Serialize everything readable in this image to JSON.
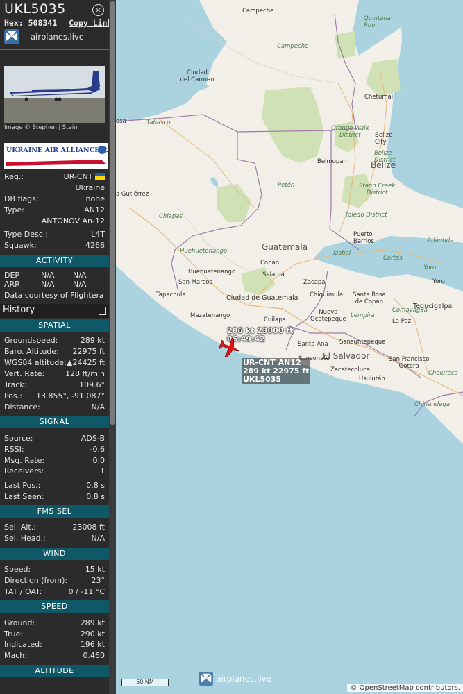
{
  "header": {
    "callsign": "UKL5035",
    "hex_label": "Hex:",
    "hex": "508341",
    "copy_link": "Copy Link",
    "site": "airplanes.live",
    "close": "×"
  },
  "photo": {
    "credit": "Image © Stephen J Stein"
  },
  "operator_logo": {
    "text": "UKRAINE AIR ALLIANCE P.JSC."
  },
  "aircraft": {
    "reg_label": "Reg.:",
    "reg": "UR-CNT",
    "country": "Ukraine",
    "dbflags_label": "DB flags:",
    "dbflags": "none",
    "type_label": "Type:",
    "type": "AN12",
    "type_name": "ANTONOV An-12",
    "typedesc_label": "Type Desc.:",
    "typedesc": "L4T",
    "squawk_label": "Squawk:",
    "squawk": "4266"
  },
  "activity": {
    "title": "ACTIVITY",
    "dep_label": "DEP",
    "dep_a": "N/A",
    "dep_b": "N/A",
    "arr_label": "ARR",
    "arr_a": "N/A",
    "arr_b": "N/A",
    "courtesy": "Data courtesy of",
    "courtesy_source": "Flightera"
  },
  "history": {
    "title": "History"
  },
  "spatial": {
    "title": "SPATIAL",
    "groundspeed_label": "Groundspeed:",
    "groundspeed": "289 kt",
    "baro_label": "Baro. Altitude:",
    "baro": "22975 ft",
    "wgs_label": "WGS84 altitude:",
    "wgs": "▲24425 ft",
    "vrate_label": "Vert. Rate:",
    "vrate": "128 ft/min",
    "track_label": "Track:",
    "track": "109.6°",
    "pos_label": "Pos.:",
    "pos": "13.855°, -91.087°",
    "dist_label": "Distance:",
    "dist": "N/A"
  },
  "signal": {
    "title": "SIGNAL",
    "source_label": "Source:",
    "source": "ADS-B",
    "rssi_label": "RSSI:",
    "rssi": "-0.6",
    "msgrate_label": "Msg. Rate:",
    "msgrate": "0.0",
    "receivers_label": "Receivers:",
    "receivers": "1",
    "lastpos_label": "Last Pos.:",
    "lastpos": "0.8 s",
    "lastseen_label": "Last Seen:",
    "lastseen": "0.8 s"
  },
  "fms": {
    "title": "FMS SEL",
    "selalt_label": "Sel. Alt.:",
    "selalt": "23008 ft",
    "selhead_label": "Sel. Head.:",
    "selhead": "N/A"
  },
  "wind": {
    "title": "WIND",
    "speed_label": "Speed:",
    "speed": "15 kt",
    "dir_label": "Direction (from):",
    "dir": "23°",
    "tat_label": "TAT / OAT:",
    "tat": "0 / -11 °C"
  },
  "speed": {
    "title": "SPEED",
    "ground_label": "Ground:",
    "ground": "289 kt",
    "true_label": "True:",
    "true": "290 kt",
    "ind_label": "Indicated:",
    "ind": "196 kt",
    "mach_label": "Mach:",
    "mach": "0.460"
  },
  "altitude": {
    "title": "ALTITUDE"
  },
  "map": {
    "labels": {
      "campeche": "Campeche",
      "campeche_state": "Campeche",
      "ciudad_carmen": "Ciudad\ndel Carmen",
      "quintana": "Quintana\nRoo",
      "chetumal": "Chetumal",
      "tabasco": "Tabasco",
      "osa": "osa",
      "orange_walk": "Orange Walk\nDistrict",
      "belize_city": "Belize\nCity",
      "belize_district": "Belize\nDistrict",
      "belmopan": "Belmopan",
      "belize": "Belize",
      "gutierrez": "a Gutiérrez",
      "peten": "Petén",
      "stann_creek": "Stann Creek\nDistrict",
      "chiapas": "Chiapas",
      "toledo": "Toledo District",
      "puerto_barrios": "Puerto\nBarrios",
      "huehuetenango_dept": "Huehuetenango",
      "guatemala": "Guatemala",
      "izabal": "Izabal",
      "atlantida": "Atlántida",
      "huehuetenango": "Huehuetenango",
      "coban": "Cobán",
      "cortes": "Cortés",
      "yoro": "Yoro",
      "yoro2": "Yoro",
      "salama": "Salamá",
      "san_marcos": "San Marcos",
      "zacapa": "Zacapa",
      "tapachula": "Tapachula",
      "ciudad_guatemala": "Ciudad de Guatemala",
      "chiquimula": "Chiquimula",
      "santa_rosa": "Santa Rosa\nde Copán",
      "mazatenango": "Mazatenango",
      "cuilapa": "Cuilapa",
      "nueva": "Nueva\nOcotepeque",
      "lempira": "Lempira",
      "comayagua": "Comayagua",
      "tegucigalpa": "Tegucigalpa",
      "la_paz": "La Paz",
      "santa_ana": "Santa Ana",
      "sensuntepeque": "Sensuntepeque",
      "el_salvador": "El Salvador",
      "sonsonate": "Sonsonate",
      "zacatecoluca": "Zacatecoluca",
      "san_francisco": "San Francisco\nGotera",
      "choluteca": "Choluteca",
      "usulutan": "Usulután",
      "chinandega": "Chinandega"
    },
    "hover_label_1": "286 kt  23000 ft",
    "hover_label_2": "06:49:42",
    "plane_label_1": "UR-CNT AN12",
    "plane_label_2": "289 kt  22975 ft",
    "plane_label_3": "UKL5035",
    "scale": "50 NM",
    "watermark": "airplanes.live",
    "attribution": "© OpenStreetMap contributors."
  },
  "colors": {
    "section_bg": "#0e5868",
    "plane": "#e0161c",
    "sea": "#aad3df",
    "land": "#f2efe9"
  }
}
